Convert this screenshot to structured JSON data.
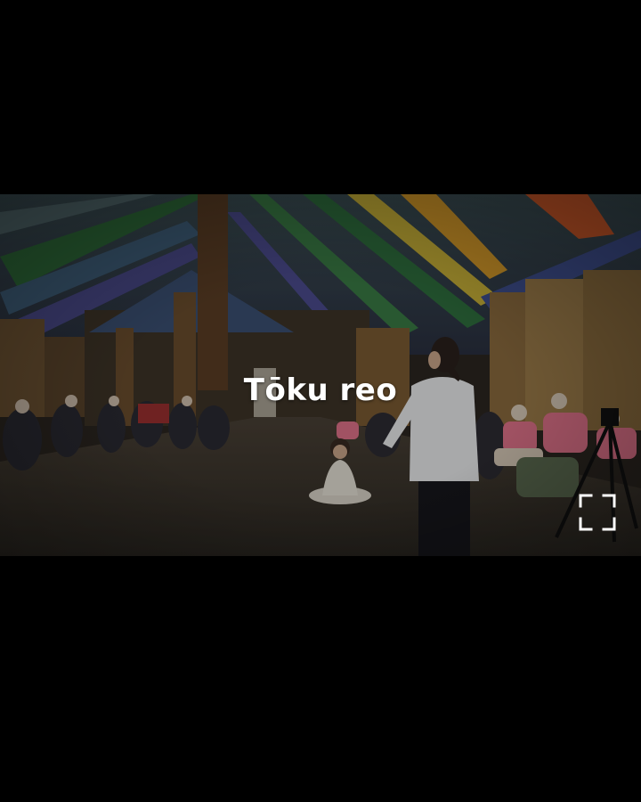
{
  "video": {
    "caption": "Tōku reo"
  },
  "controls": {
    "fullscreen_icon": "fullscreen-icon"
  },
  "colors": {
    "background": "#000000",
    "caption": "#ffffff"
  }
}
